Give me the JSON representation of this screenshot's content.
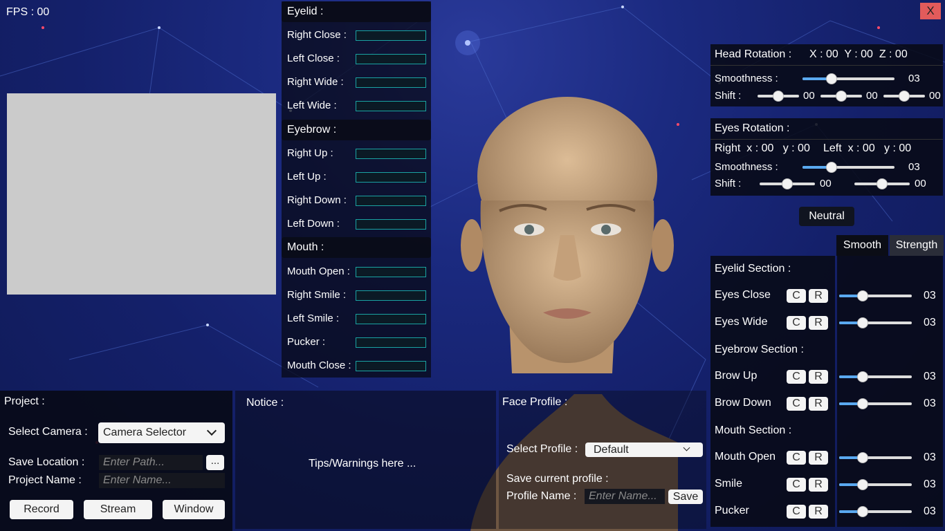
{
  "fps": "FPS : 00",
  "close_label": "X",
  "blendshapes": {
    "eyelid": {
      "title": "Eyelid :",
      "items": [
        {
          "label": "Right Close :",
          "level": 0
        },
        {
          "label": "Left Close :",
          "level": 0
        },
        {
          "label": "Right Wide :",
          "level": 0
        },
        {
          "label": "Left Wide :",
          "level": 0
        }
      ]
    },
    "eyebrow": {
      "title": "Eyebrow :",
      "items": [
        {
          "label": "Right Up :",
          "level": 0
        },
        {
          "label": "Left Up :",
          "level": 0
        },
        {
          "label": "Right Down :",
          "level": 0
        },
        {
          "label": "Left Down :",
          "level": 0
        }
      ]
    },
    "mouth": {
      "title": "Mouth :",
      "items": [
        {
          "label": "Mouth Open :",
          "level": 0
        },
        {
          "label": "Right Smile :",
          "level": 0
        },
        {
          "label": "Left Smile :",
          "level": 0
        },
        {
          "label": "Pucker :",
          "level": 0
        },
        {
          "label": "Mouth Close :",
          "level": 0
        }
      ]
    }
  },
  "head": {
    "title": "Head Rotation :",
    "xyz": "X : 00  Y : 00  Z : 00",
    "smooth_label": "Smoothness :",
    "smooth_val": "03",
    "shift_label": "Shift :",
    "shift_vals": [
      "00",
      "00",
      "00"
    ]
  },
  "eyes": {
    "title": "Eyes Rotation :",
    "right": "Right  x : 00   y : 00",
    "left": "Left  x : 00   y : 00",
    "smooth_label": "Smoothness :",
    "smooth_val": "03",
    "shift_label": "Shift :",
    "shift_vals": [
      "00",
      "00"
    ]
  },
  "neutral_label": "Neutral",
  "tabs": {
    "smooth": "Smooth",
    "strength": "Strength"
  },
  "sections": {
    "eyelid_title": "Eyelid Section :",
    "eyebrow_title": "Eyebrow Section :",
    "mouth_title": "Mouth Section :",
    "rows": [
      {
        "label": "Eyes Close",
        "val": "03"
      },
      {
        "label": "Eyes Wide",
        "val": "03"
      },
      {
        "label": "Brow Up",
        "val": "03"
      },
      {
        "label": "Brow Down",
        "val": "03"
      },
      {
        "label": "Mouth Open",
        "val": "03"
      },
      {
        "label": "Smile",
        "val": "03"
      },
      {
        "label": "Pucker",
        "val": "03"
      }
    ],
    "c": "C",
    "r": "R"
  },
  "project": {
    "title": "Project :",
    "camera_label": "Select Camera :",
    "camera_value": "Camera Selector",
    "save_loc_label": "Save Location :",
    "path_placeholder": "Enter Path...",
    "browse": "...",
    "name_label": "Project Name :",
    "name_placeholder": "Enter Name...",
    "record": "Record",
    "stream": "Stream",
    "window": "Window"
  },
  "notice": {
    "title": "Notice :",
    "text": "Tips/Warnings here ..."
  },
  "profile": {
    "title": "Face Profile :",
    "select_label": "Select Profile :",
    "select_value": "Default",
    "save_label": "Save current profile :",
    "name_label": "Profile Name :",
    "name_placeholder": "Enter Name...",
    "save_btn": "Save"
  },
  "colors": {
    "slider_fill": "#5aa9f0",
    "meter_border": "#1aa3a3",
    "close_bg": "#e25b5b",
    "skin": "#c9a27a"
  }
}
